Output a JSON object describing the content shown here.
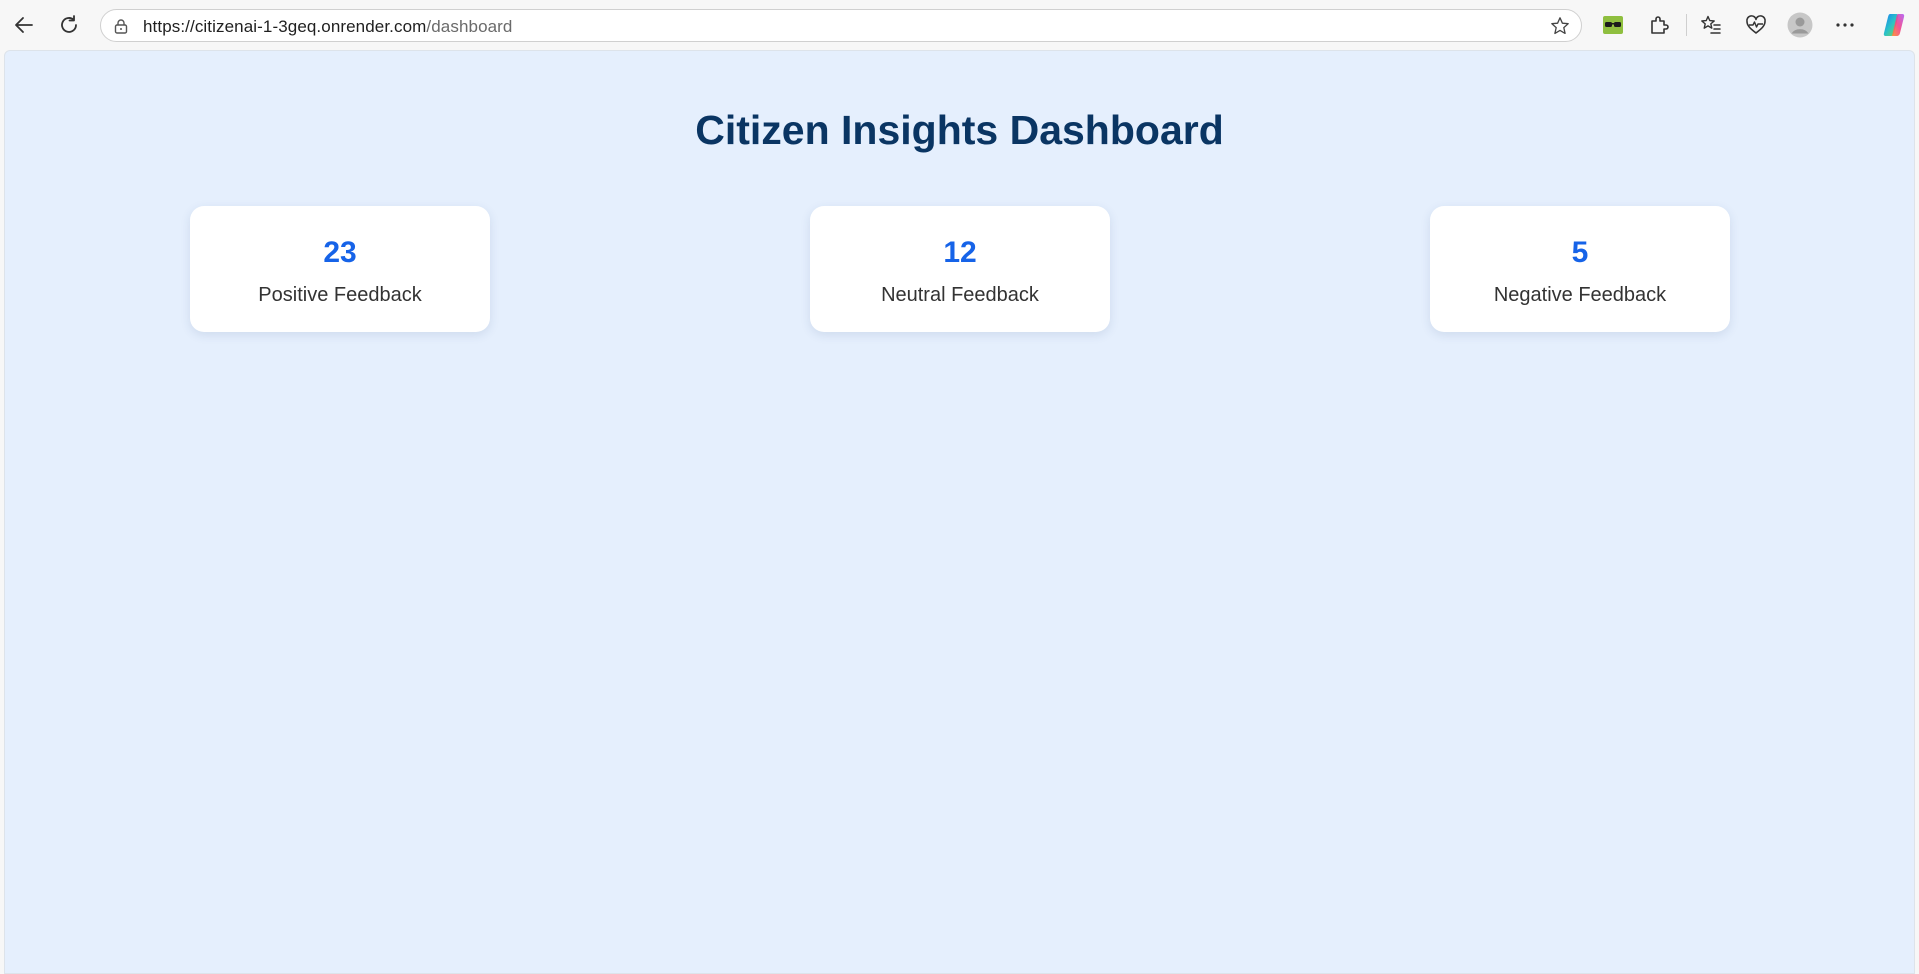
{
  "browser": {
    "url_base": "https://citizenai-1-3geq.onrender.com",
    "url_path": "/dashboard"
  },
  "page": {
    "title": "Citizen Insights Dashboard"
  },
  "cards": [
    {
      "value": "23",
      "label": "Positive Feedback"
    },
    {
      "value": "12",
      "label": "Neutral Feedback"
    },
    {
      "value": "5",
      "label": "Negative Feedback"
    }
  ],
  "colors": {
    "background": "#e5effd",
    "title": "#0a3563",
    "accent": "#1663e8"
  },
  "icons": [
    "back-arrow-icon",
    "refresh-icon",
    "site-info-lock-icon",
    "favorite-star-icon",
    "glasses-extension-icon",
    "extensions-puzzle-icon",
    "favorites-list-icon",
    "browser-health-icon",
    "profile-avatar-icon",
    "more-menu-icon",
    "copilot-icon"
  ]
}
